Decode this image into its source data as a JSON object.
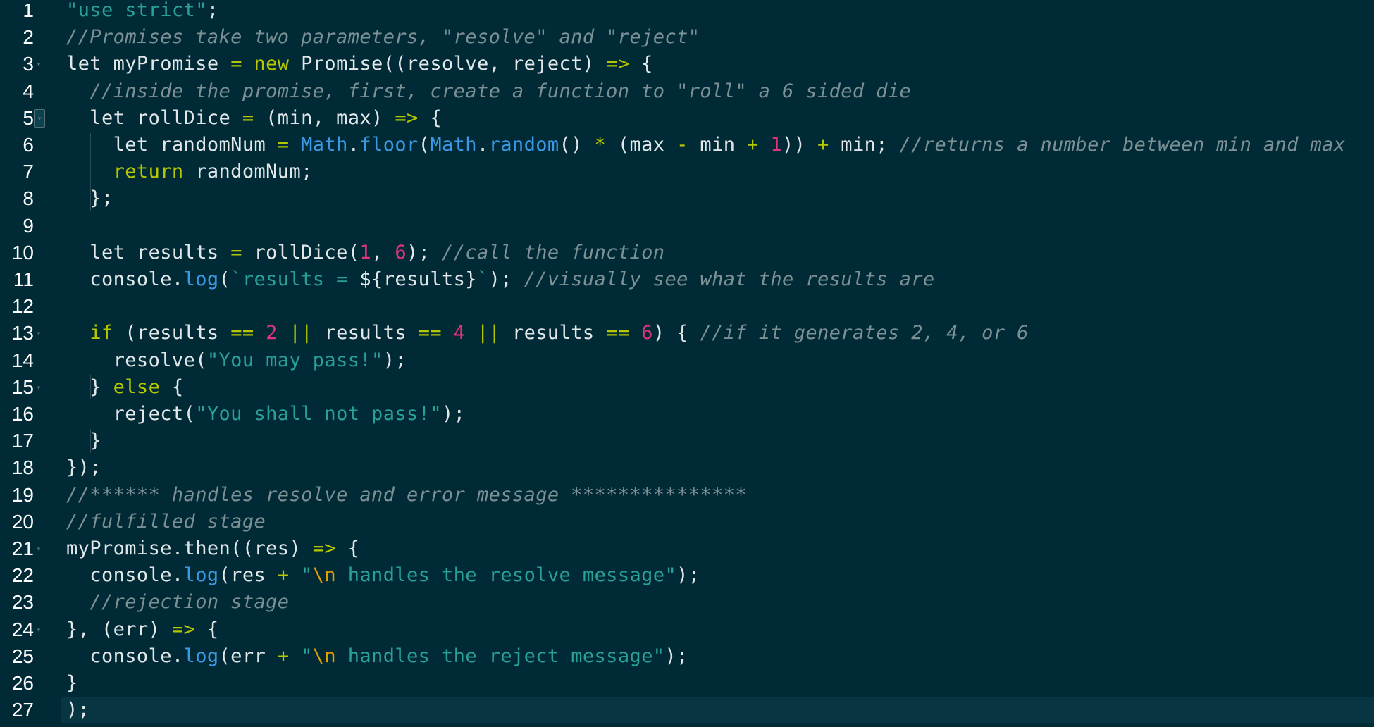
{
  "editor": {
    "theme_colors": {
      "background": "#002b36",
      "active_line": "#073642",
      "string": "#2aa198",
      "comment": "#7c9095",
      "keyword": "#b5c700",
      "number": "#e0337c",
      "builtin": "#3b9ae6",
      "escape": "#e39e00",
      "text": "#e2e8ea"
    },
    "active_line": 27,
    "lines": [
      {
        "n": "1",
        "fold": "",
        "tokens": [
          [
            "str",
            "\"use strict\""
          ],
          [
            "id",
            ";"
          ]
        ]
      },
      {
        "n": "2",
        "fold": "",
        "tokens": [
          [
            "cm",
            "//Promises take two parameters, \"resolve\" and \"reject\""
          ]
        ]
      },
      {
        "n": "3",
        "fold": "open",
        "tokens": [
          [
            "id",
            "let myPromise "
          ],
          [
            "op",
            "="
          ],
          [
            "id",
            " "
          ],
          [
            "kw",
            "new"
          ],
          [
            "id",
            " Promise((resolve, reject) "
          ],
          [
            "op",
            "=>"
          ],
          [
            "id",
            " {"
          ]
        ]
      },
      {
        "n": "4",
        "fold": "",
        "tokens": [
          [
            "id",
            "  "
          ],
          [
            "cm",
            "//inside the promise, first, create a function to \"roll\" a 6 sided die"
          ]
        ]
      },
      {
        "n": "5",
        "fold": "boxed",
        "tokens": [
          [
            "id",
            "  let rollDice "
          ],
          [
            "op",
            "="
          ],
          [
            "id",
            " (min, max) "
          ],
          [
            "op",
            "=>"
          ],
          [
            "id",
            " {"
          ]
        ]
      },
      {
        "n": "6",
        "fold": "",
        "tokens": [
          [
            "id",
            "    let randomNum "
          ],
          [
            "op",
            "="
          ],
          [
            "id",
            " "
          ],
          [
            "bi",
            "Math"
          ],
          [
            "id",
            "."
          ],
          [
            "bi",
            "floor"
          ],
          [
            "id",
            "("
          ],
          [
            "bi",
            "Math"
          ],
          [
            "id",
            "."
          ],
          [
            "bi",
            "random"
          ],
          [
            "id",
            "() "
          ],
          [
            "op",
            "*"
          ],
          [
            "id",
            " (max "
          ],
          [
            "op",
            "-"
          ],
          [
            "id",
            " min "
          ],
          [
            "op",
            "+"
          ],
          [
            "id",
            " "
          ],
          [
            "num",
            "1"
          ],
          [
            "id",
            ")) "
          ],
          [
            "op",
            "+"
          ],
          [
            "id",
            " min; "
          ],
          [
            "cm",
            "//returns a number between min and max"
          ]
        ]
      },
      {
        "n": "7",
        "fold": "",
        "tokens": [
          [
            "id",
            "    "
          ],
          [
            "kw",
            "return"
          ],
          [
            "id",
            " randomNum;"
          ]
        ]
      },
      {
        "n": "8",
        "fold": "",
        "tokens": [
          [
            "id",
            "  };"
          ]
        ]
      },
      {
        "n": "9",
        "fold": "",
        "tokens": []
      },
      {
        "n": "10",
        "fold": "",
        "tokens": [
          [
            "id",
            "  let results "
          ],
          [
            "op",
            "="
          ],
          [
            "id",
            " rollDice("
          ],
          [
            "num",
            "1"
          ],
          [
            "id",
            ", "
          ],
          [
            "num",
            "6"
          ],
          [
            "id",
            "); "
          ],
          [
            "cm",
            "//call the function"
          ]
        ]
      },
      {
        "n": "11",
        "fold": "",
        "tokens": [
          [
            "id",
            "  console."
          ],
          [
            "bi",
            "log"
          ],
          [
            "id",
            "("
          ],
          [
            "str",
            "`results = "
          ],
          [
            "id",
            "${results}"
          ],
          [
            "str",
            "`"
          ],
          [
            "id",
            "); "
          ],
          [
            "cm",
            "//visually see what the results are"
          ]
        ]
      },
      {
        "n": "12",
        "fold": "",
        "tokens": []
      },
      {
        "n": "13",
        "fold": "open",
        "tokens": [
          [
            "id",
            "  "
          ],
          [
            "kw",
            "if"
          ],
          [
            "id",
            " (results "
          ],
          [
            "op",
            "=="
          ],
          [
            "id",
            " "
          ],
          [
            "num",
            "2"
          ],
          [
            "id",
            " "
          ],
          [
            "op",
            "||"
          ],
          [
            "id",
            " results "
          ],
          [
            "op",
            "=="
          ],
          [
            "id",
            " "
          ],
          [
            "num",
            "4"
          ],
          [
            "id",
            " "
          ],
          [
            "op",
            "||"
          ],
          [
            "id",
            " results "
          ],
          [
            "op",
            "=="
          ],
          [
            "id",
            " "
          ],
          [
            "num",
            "6"
          ],
          [
            "id",
            ") { "
          ],
          [
            "cm",
            "//if it generates 2, 4, or 6"
          ]
        ]
      },
      {
        "n": "14",
        "fold": "",
        "tokens": [
          [
            "id",
            "    resolve("
          ],
          [
            "str",
            "\"You may pass!\""
          ],
          [
            "id",
            ");"
          ]
        ]
      },
      {
        "n": "15",
        "fold": "open",
        "tokens": [
          [
            "id",
            "  } "
          ],
          [
            "kw",
            "else"
          ],
          [
            "id",
            " {"
          ]
        ]
      },
      {
        "n": "16",
        "fold": "",
        "tokens": [
          [
            "id",
            "    reject("
          ],
          [
            "str",
            "\"You shall not pass!\""
          ],
          [
            "id",
            ");"
          ]
        ]
      },
      {
        "n": "17",
        "fold": "",
        "tokens": [
          [
            "id",
            "  }"
          ]
        ]
      },
      {
        "n": "18",
        "fold": "",
        "tokens": [
          [
            "id",
            "});"
          ]
        ]
      },
      {
        "n": "19",
        "fold": "",
        "tokens": [
          [
            "cm",
            "//****** handles resolve and error message ***************"
          ]
        ]
      },
      {
        "n": "20",
        "fold": "",
        "tokens": [
          [
            "cm",
            "//fulfilled stage"
          ]
        ]
      },
      {
        "n": "21",
        "fold": "open",
        "tokens": [
          [
            "id",
            "myPromise.then((res) "
          ],
          [
            "op",
            "=>"
          ],
          [
            "id",
            " {"
          ]
        ]
      },
      {
        "n": "22",
        "fold": "",
        "tokens": [
          [
            "id",
            "  console."
          ],
          [
            "bi",
            "log"
          ],
          [
            "id",
            "(res "
          ],
          [
            "op",
            "+"
          ],
          [
            "id",
            " "
          ],
          [
            "str",
            "\""
          ],
          [
            "esc",
            "\\n"
          ],
          [
            "str",
            " handles the resolve message\""
          ],
          [
            "id",
            ");"
          ]
        ]
      },
      {
        "n": "23",
        "fold": "",
        "tokens": [
          [
            "id",
            "  "
          ],
          [
            "cm",
            "//rejection stage"
          ]
        ]
      },
      {
        "n": "24",
        "fold": "open",
        "tokens": [
          [
            "id",
            "}, (err) "
          ],
          [
            "op",
            "=>"
          ],
          [
            "id",
            " {"
          ]
        ]
      },
      {
        "n": "25",
        "fold": "",
        "tokens": [
          [
            "id",
            "  console."
          ],
          [
            "bi",
            "log"
          ],
          [
            "id",
            "(err "
          ],
          [
            "op",
            "+"
          ],
          [
            "id",
            " "
          ],
          [
            "str",
            "\""
          ],
          [
            "esc",
            "\\n"
          ],
          [
            "str",
            " handles the reject message\""
          ],
          [
            "id",
            ");"
          ]
        ]
      },
      {
        "n": "26",
        "fold": "",
        "tokens": [
          [
            "id",
            "}"
          ]
        ]
      },
      {
        "n": "27",
        "fold": "",
        "tokens": [
          [
            "id",
            ");"
          ]
        ]
      }
    ]
  }
}
